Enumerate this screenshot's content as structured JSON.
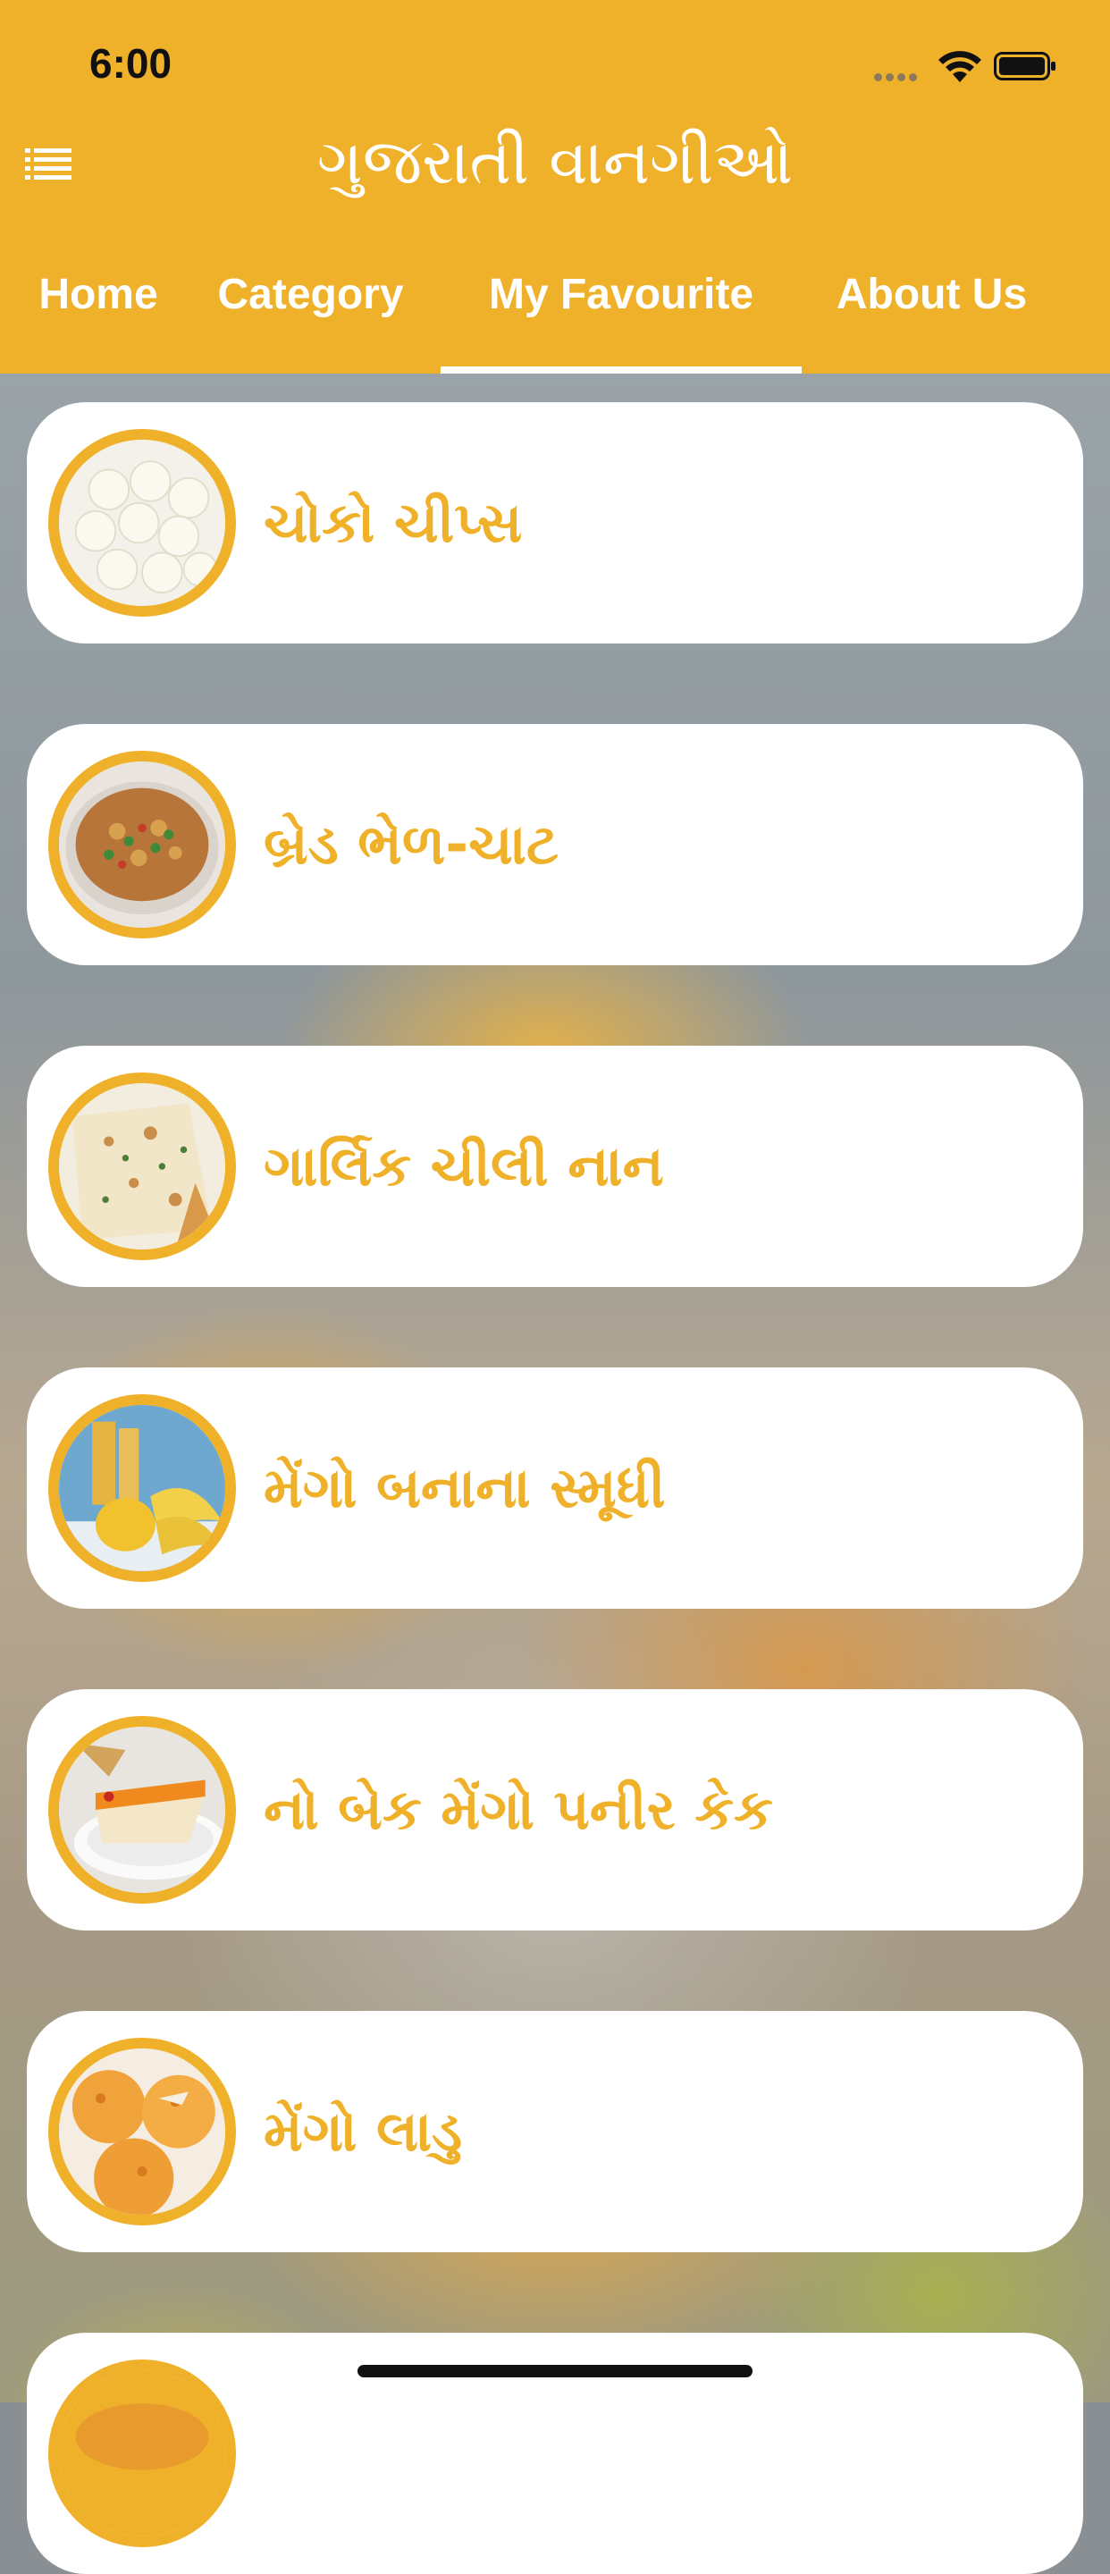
{
  "status_bar": {
    "time": "6:00"
  },
  "header": {
    "title": "ગુજરાતી વાનગીઓ",
    "menu_icon": "list-menu-icon",
    "background_color": "#F0B12A"
  },
  "tabs": [
    {
      "label": "Home",
      "selected": false
    },
    {
      "label": "Category",
      "selected": false
    },
    {
      "label": "My Favourite",
      "selected": true
    },
    {
      "label": "About Us",
      "selected": false
    }
  ],
  "favourites": [
    {
      "title": "ચોકો ચીપ્સ",
      "image": "choco-chips-photo"
    },
    {
      "title": "બ્રેડ ભેળ-ચાટ",
      "image": "bread-bhel-chaat-photo"
    },
    {
      "title": "ગાર્લિક ચીલી નાન",
      "image": "garlic-chili-naan-photo"
    },
    {
      "title": "મેંગો બનાના સ્મૂધી",
      "image": "mango-banana-smoothie-photo"
    },
    {
      "title": "નો બેક મેંગો પનીર કેક",
      "image": "no-bake-mango-paneer-cake-photo"
    },
    {
      "title": "મેંગો લાડુ",
      "image": "mango-ladoo-photo"
    },
    {
      "title": "",
      "image": "partial-item-photo"
    }
  ],
  "accent_color": "#F0B12A"
}
